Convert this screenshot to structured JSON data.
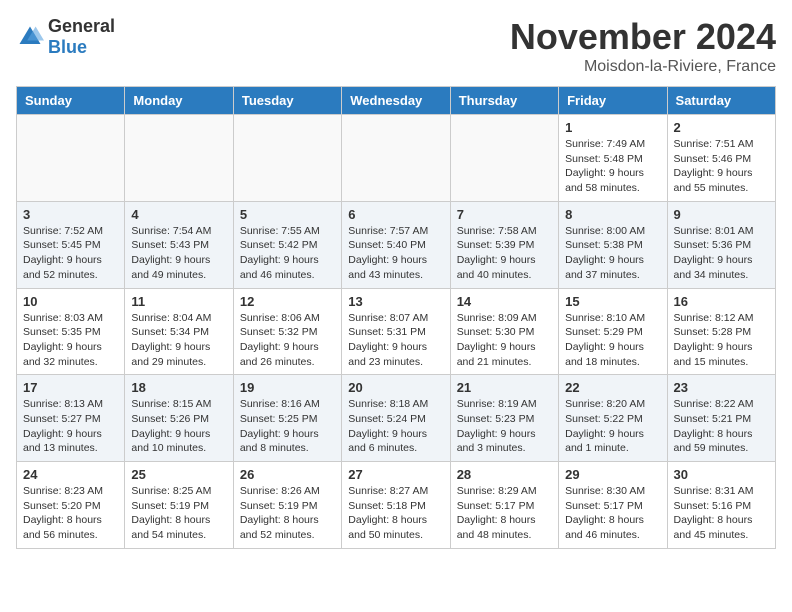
{
  "logo": {
    "general": "General",
    "blue": "Blue"
  },
  "title": "November 2024",
  "location": "Moisdon-la-Riviere, France",
  "weekdays": [
    "Sunday",
    "Monday",
    "Tuesday",
    "Wednesday",
    "Thursday",
    "Friday",
    "Saturday"
  ],
  "weeks": [
    [
      {
        "day": "",
        "info": ""
      },
      {
        "day": "",
        "info": ""
      },
      {
        "day": "",
        "info": ""
      },
      {
        "day": "",
        "info": ""
      },
      {
        "day": "",
        "info": ""
      },
      {
        "day": "1",
        "info": "Sunrise: 7:49 AM\nSunset: 5:48 PM\nDaylight: 9 hours and 58 minutes."
      },
      {
        "day": "2",
        "info": "Sunrise: 7:51 AM\nSunset: 5:46 PM\nDaylight: 9 hours and 55 minutes."
      }
    ],
    [
      {
        "day": "3",
        "info": "Sunrise: 7:52 AM\nSunset: 5:45 PM\nDaylight: 9 hours and 52 minutes."
      },
      {
        "day": "4",
        "info": "Sunrise: 7:54 AM\nSunset: 5:43 PM\nDaylight: 9 hours and 49 minutes."
      },
      {
        "day": "5",
        "info": "Sunrise: 7:55 AM\nSunset: 5:42 PM\nDaylight: 9 hours and 46 minutes."
      },
      {
        "day": "6",
        "info": "Sunrise: 7:57 AM\nSunset: 5:40 PM\nDaylight: 9 hours and 43 minutes."
      },
      {
        "day": "7",
        "info": "Sunrise: 7:58 AM\nSunset: 5:39 PM\nDaylight: 9 hours and 40 minutes."
      },
      {
        "day": "8",
        "info": "Sunrise: 8:00 AM\nSunset: 5:38 PM\nDaylight: 9 hours and 37 minutes."
      },
      {
        "day": "9",
        "info": "Sunrise: 8:01 AM\nSunset: 5:36 PM\nDaylight: 9 hours and 34 minutes."
      }
    ],
    [
      {
        "day": "10",
        "info": "Sunrise: 8:03 AM\nSunset: 5:35 PM\nDaylight: 9 hours and 32 minutes."
      },
      {
        "day": "11",
        "info": "Sunrise: 8:04 AM\nSunset: 5:34 PM\nDaylight: 9 hours and 29 minutes."
      },
      {
        "day": "12",
        "info": "Sunrise: 8:06 AM\nSunset: 5:32 PM\nDaylight: 9 hours and 26 minutes."
      },
      {
        "day": "13",
        "info": "Sunrise: 8:07 AM\nSunset: 5:31 PM\nDaylight: 9 hours and 23 minutes."
      },
      {
        "day": "14",
        "info": "Sunrise: 8:09 AM\nSunset: 5:30 PM\nDaylight: 9 hours and 21 minutes."
      },
      {
        "day": "15",
        "info": "Sunrise: 8:10 AM\nSunset: 5:29 PM\nDaylight: 9 hours and 18 minutes."
      },
      {
        "day": "16",
        "info": "Sunrise: 8:12 AM\nSunset: 5:28 PM\nDaylight: 9 hours and 15 minutes."
      }
    ],
    [
      {
        "day": "17",
        "info": "Sunrise: 8:13 AM\nSunset: 5:27 PM\nDaylight: 9 hours and 13 minutes."
      },
      {
        "day": "18",
        "info": "Sunrise: 8:15 AM\nSunset: 5:26 PM\nDaylight: 9 hours and 10 minutes."
      },
      {
        "day": "19",
        "info": "Sunrise: 8:16 AM\nSunset: 5:25 PM\nDaylight: 9 hours and 8 minutes."
      },
      {
        "day": "20",
        "info": "Sunrise: 8:18 AM\nSunset: 5:24 PM\nDaylight: 9 hours and 6 minutes."
      },
      {
        "day": "21",
        "info": "Sunrise: 8:19 AM\nSunset: 5:23 PM\nDaylight: 9 hours and 3 minutes."
      },
      {
        "day": "22",
        "info": "Sunrise: 8:20 AM\nSunset: 5:22 PM\nDaylight: 9 hours and 1 minute."
      },
      {
        "day": "23",
        "info": "Sunrise: 8:22 AM\nSunset: 5:21 PM\nDaylight: 8 hours and 59 minutes."
      }
    ],
    [
      {
        "day": "24",
        "info": "Sunrise: 8:23 AM\nSunset: 5:20 PM\nDaylight: 8 hours and 56 minutes."
      },
      {
        "day": "25",
        "info": "Sunrise: 8:25 AM\nSunset: 5:19 PM\nDaylight: 8 hours and 54 minutes."
      },
      {
        "day": "26",
        "info": "Sunrise: 8:26 AM\nSunset: 5:19 PM\nDaylight: 8 hours and 52 minutes."
      },
      {
        "day": "27",
        "info": "Sunrise: 8:27 AM\nSunset: 5:18 PM\nDaylight: 8 hours and 50 minutes."
      },
      {
        "day": "28",
        "info": "Sunrise: 8:29 AM\nSunset: 5:17 PM\nDaylight: 8 hours and 48 minutes."
      },
      {
        "day": "29",
        "info": "Sunrise: 8:30 AM\nSunset: 5:17 PM\nDaylight: 8 hours and 46 minutes."
      },
      {
        "day": "30",
        "info": "Sunrise: 8:31 AM\nSunset: 5:16 PM\nDaylight: 8 hours and 45 minutes."
      }
    ]
  ]
}
